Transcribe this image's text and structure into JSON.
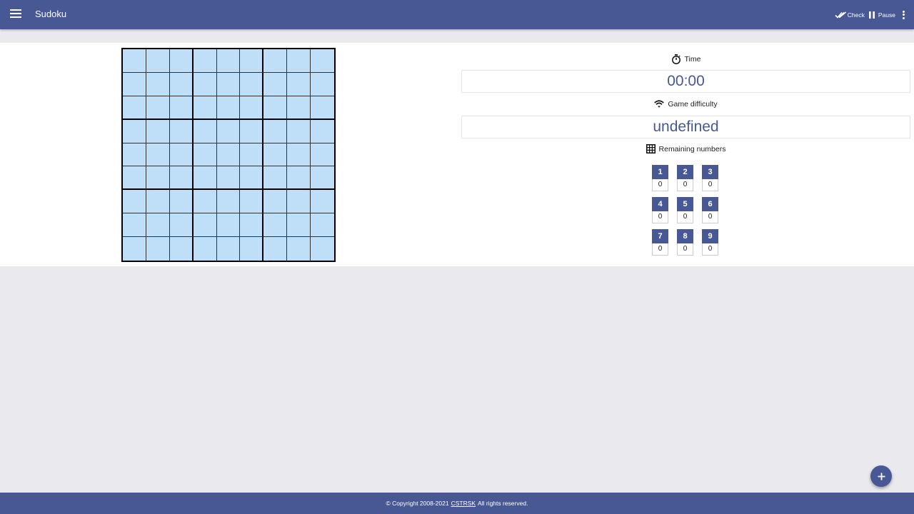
{
  "app": {
    "title": "Sudoku"
  },
  "toolbar": {
    "check_label": "Check",
    "pause_label": "Pause",
    "menu_icon": "menu-icon",
    "check_icon": "double-check-icon",
    "pause_icon": "pause-icon",
    "more_icon": "more-vert-icon"
  },
  "board": {
    "size": 9,
    "cells": [
      [
        "",
        "",
        "",
        "",
        "",
        "",
        "",
        "",
        ""
      ],
      [
        "",
        "",
        "",
        "",
        "",
        "",
        "",
        "",
        ""
      ],
      [
        "",
        "",
        "",
        "",
        "",
        "",
        "",
        "",
        ""
      ],
      [
        "",
        "",
        "",
        "",
        "",
        "",
        "",
        "",
        ""
      ],
      [
        "",
        "",
        "",
        "",
        "",
        "",
        "",
        "",
        ""
      ],
      [
        "",
        "",
        "",
        "",
        "",
        "",
        "",
        "",
        ""
      ],
      [
        "",
        "",
        "",
        "",
        "",
        "",
        "",
        "",
        ""
      ],
      [
        "",
        "",
        "",
        "",
        "",
        "",
        "",
        "",
        ""
      ],
      [
        "",
        "",
        "",
        "",
        "",
        "",
        "",
        "",
        ""
      ]
    ],
    "cell_color": "#bfdff8"
  },
  "time": {
    "label": "Time",
    "value": "00:00",
    "icon": "timer-icon"
  },
  "difficulty": {
    "label": "Game difficulty",
    "value": "undefined",
    "icon": "signal-icon"
  },
  "remaining": {
    "label": "Remaining numbers",
    "icon": "grid-icon",
    "items": [
      {
        "digit": "1",
        "count": "0"
      },
      {
        "digit": "2",
        "count": "0"
      },
      {
        "digit": "3",
        "count": "0"
      },
      {
        "digit": "4",
        "count": "0"
      },
      {
        "digit": "5",
        "count": "0"
      },
      {
        "digit": "6",
        "count": "0"
      },
      {
        "digit": "7",
        "count": "0"
      },
      {
        "digit": "8",
        "count": "0"
      },
      {
        "digit": "9",
        "count": "0"
      }
    ]
  },
  "fab": {
    "icon": "plus-icon"
  },
  "footer": {
    "prefix": "© Copyright 2008-2021",
    "link": "CSTRSK",
    "suffix": "All rights reserved."
  },
  "colors": {
    "primary": "#475894",
    "background": "#e9e9ee",
    "cell": "#bfdff8"
  }
}
